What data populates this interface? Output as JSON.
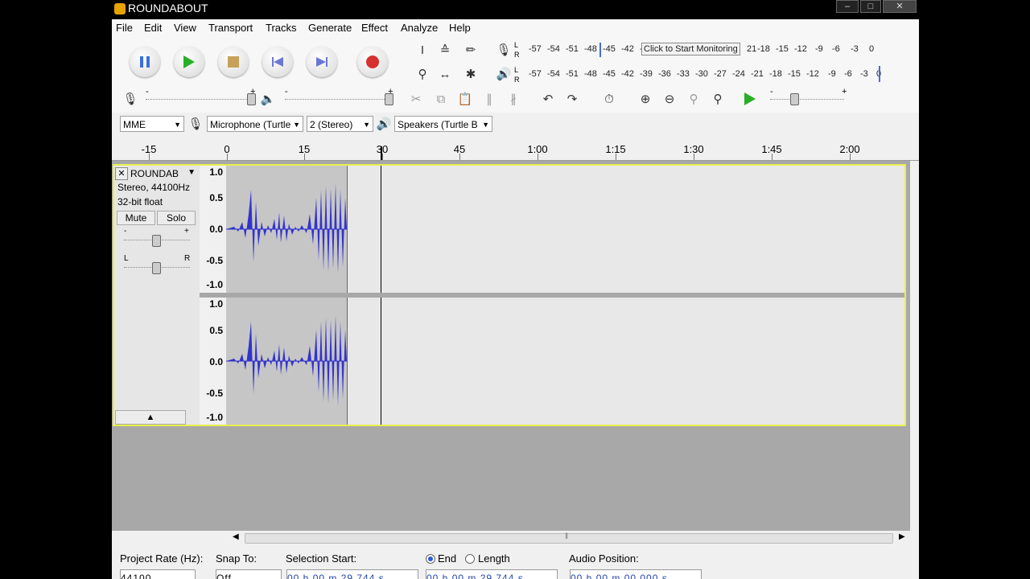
{
  "window": {
    "title": "ROUNDABOUT"
  },
  "menu": [
    "File",
    "Edit",
    "View",
    "Transport",
    "Tracks",
    "Generate",
    "Effect",
    "Analyze",
    "Help"
  ],
  "transport": {
    "pause": "pause-icon",
    "play": "play-icon",
    "stop": "stop-icon",
    "skip_start": "skip-start-icon",
    "skip_end": "skip-end-icon",
    "record": "record-icon"
  },
  "meters": {
    "record_scale": [
      "-57",
      "-54",
      "-51",
      "-48",
      "-45",
      "-42",
      "-3"
    ],
    "record_hint": "Click to Start Monitoring",
    "record_scale_tail": [
      "21",
      "-18",
      "-15",
      "-12",
      "-9",
      "-6",
      "-3",
      "0"
    ],
    "play_scale": [
      "-57",
      "-54",
      "-51",
      "-48",
      "-45",
      "-42",
      "-39",
      "-36",
      "-33",
      "-30",
      "-27",
      "-24",
      "-21",
      "-18",
      "-15",
      "-12",
      "-9",
      "-6",
      "-3",
      "0"
    ],
    "lr_left": "L",
    "lr_right": "R"
  },
  "slider_marks": {
    "minus": "-",
    "plus": "+"
  },
  "device": {
    "host": "MME",
    "input": "Microphone (Turtle",
    "channels": "2 (Stereo)",
    "output": "Speakers (Turtle B"
  },
  "timeline": {
    "labels": [
      "-15",
      "0",
      "15",
      "30",
      "45",
      "1:00",
      "1:15",
      "1:30",
      "1:45",
      "2:00"
    ]
  },
  "track": {
    "name": "ROUNDAB",
    "info1": "Stereo, 44100Hz",
    "info2": "32-bit float",
    "mute": "Mute",
    "solo": "Solo",
    "gain_minus": "-",
    "gain_plus": "+",
    "pan_left": "L",
    "pan_right": "R",
    "scale": [
      "1.0",
      "0.5",
      "0.0",
      "-0.5",
      "-1.0"
    ]
  },
  "selection": {
    "project_rate_label": "Project Rate (Hz):",
    "project_rate": "44100",
    "snap_label": "Snap To:",
    "snap_value": "Off",
    "selection_start_label": "Selection Start:",
    "end_label": "End",
    "length_label": "Length",
    "audio_position_label": "Audio Position:",
    "start_time": "00 h 00 m 29.744 s",
    "end_time": "00 h 00 m 29.744 s",
    "audio_position": "00 h 00 m 00.000 s"
  }
}
